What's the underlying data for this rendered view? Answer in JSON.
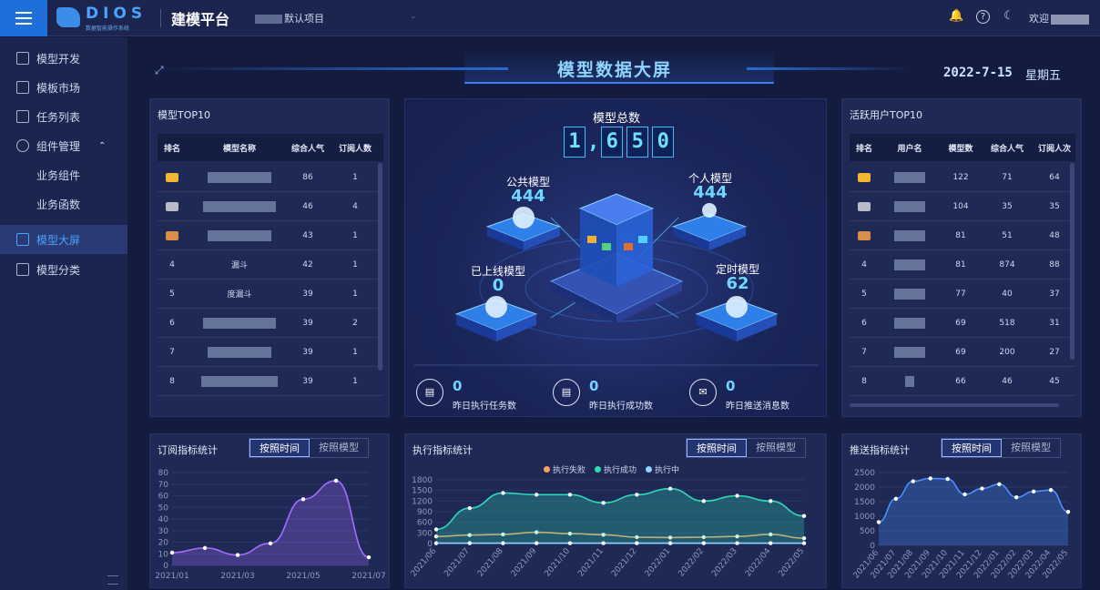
{
  "topbar": {
    "logo_text": "DIOS",
    "logo_sub": "数据智能操作系统",
    "platform": "建模平台",
    "project": "默认项目",
    "welcome": "欢迎"
  },
  "sidebar": {
    "items": [
      {
        "label": "模型开发"
      },
      {
        "label": "模板市场"
      },
      {
        "label": "任务列表"
      },
      {
        "label": "组件管理"
      },
      {
        "label": "业务组件"
      },
      {
        "label": "业务函数"
      },
      {
        "label": "模型大屏"
      },
      {
        "label": "模型分类"
      }
    ]
  },
  "screen": {
    "title": "模型数据大屏",
    "date": "2022-7-15",
    "weekday": "星期五"
  },
  "model_top10": {
    "title": "模型TOP10",
    "columns": [
      "排名",
      "模型名称",
      "综合人气",
      "订阅人数"
    ],
    "rows": [
      {
        "rank": "",
        "name": "",
        "popularity": "86",
        "subscribers": "1"
      },
      {
        "rank": "",
        "name": "",
        "popularity": "46",
        "subscribers": "4"
      },
      {
        "rank": "",
        "name": "",
        "popularity": "43",
        "subscribers": "1"
      },
      {
        "rank": "4",
        "name": "漏斗",
        "popularity": "42",
        "subscribers": "1"
      },
      {
        "rank": "5",
        "name": "度漏斗",
        "popularity": "39",
        "subscribers": "1"
      },
      {
        "rank": "6",
        "name": "",
        "popularity": "39",
        "subscribers": "2"
      },
      {
        "rank": "7",
        "name": "",
        "popularity": "39",
        "subscribers": "1"
      },
      {
        "rank": "8",
        "name": "",
        "popularity": "39",
        "subscribers": "1"
      }
    ]
  },
  "overview": {
    "total_label": "模型总数",
    "total_digits": [
      "1",
      ",",
      "6",
      "5",
      "0"
    ],
    "public_label": "公共模型",
    "public_value": "444",
    "personal_label": "个人模型",
    "personal_value": "444",
    "online_label": "已上线模型",
    "online_value": "0",
    "scheduled_label": "定时模型",
    "scheduled_value": "62",
    "bottom": [
      {
        "value": "0",
        "label": "昨日执行任务数"
      },
      {
        "value": "0",
        "label": "昨日执行成功数"
      },
      {
        "value": "0",
        "label": "昨日推送消息数"
      }
    ]
  },
  "user_top10": {
    "title": "活跃用户TOP10",
    "columns": [
      "排名",
      "用户名",
      "模型数",
      "综合人气",
      "订阅人次"
    ],
    "rows": [
      {
        "rank": "",
        "models": "122",
        "popularity": "71",
        "subs": "64"
      },
      {
        "rank": "",
        "models": "104",
        "popularity": "35",
        "subs": "35"
      },
      {
        "rank": "",
        "models": "81",
        "popularity": "51",
        "subs": "48"
      },
      {
        "rank": "4",
        "models": "81",
        "popularity": "874",
        "subs": "88"
      },
      {
        "rank": "5",
        "models": "77",
        "popularity": "40",
        "subs": "37"
      },
      {
        "rank": "6",
        "models": "69",
        "popularity": "518",
        "subs": "31"
      },
      {
        "rank": "7",
        "models": "69",
        "popularity": "200",
        "subs": "27"
      },
      {
        "rank": "8",
        "models": "66",
        "popularity": "46",
        "subs": "45"
      }
    ]
  },
  "tabs": {
    "by_time": "按照时间",
    "by_model": "按照模型"
  },
  "subscribe_panel": {
    "title": "订阅指标统计"
  },
  "exec_panel": {
    "title": "执行指标统计"
  },
  "push_panel": {
    "title": "推送指标统计"
  },
  "chart_data": [
    {
      "type": "area",
      "yticks": [
        0,
        10,
        20,
        30,
        40,
        50,
        60,
        70,
        80
      ],
      "ylim": [
        0,
        80
      ],
      "xticks": [
        "2021/01",
        "2021/03",
        "2021/05",
        "2021/07"
      ],
      "points": [
        [
          0,
          11
        ],
        [
          1,
          15
        ],
        [
          2,
          9
        ],
        [
          3,
          19
        ],
        [
          4,
          57
        ],
        [
          5,
          73
        ],
        [
          6,
          7
        ]
      ],
      "x_count": 7,
      "tick_index": [
        0,
        2,
        4,
        6
      ],
      "color": "#a46cff"
    },
    {
      "type": "line",
      "yticks": [
        0,
        300,
        600,
        900,
        1200,
        1500,
        1800
      ],
      "ylim": [
        0,
        1800
      ],
      "categories": [
        "2021/06",
        "2021/07",
        "2021/08",
        "2021/09",
        "2021/10",
        "2021/11",
        "2021/12",
        "2022/01",
        "2022/02",
        "2022/03",
        "2022/04",
        "2022/05"
      ],
      "series": [
        {
          "name": "执行失败",
          "color": "#f5a45a",
          "values": [
            200,
            240,
            260,
            320,
            280,
            250,
            180,
            170,
            180,
            200,
            260,
            150
          ]
        },
        {
          "name": "执行成功",
          "color": "#2fd9b8",
          "values": [
            400,
            1000,
            1430,
            1380,
            1380,
            1150,
            1380,
            1550,
            1200,
            1350,
            1200,
            780
          ]
        },
        {
          "name": "执行中",
          "color": "#8fd3ff",
          "values": [
            10,
            10,
            10,
            10,
            10,
            10,
            10,
            10,
            10,
            10,
            10,
            10
          ]
        }
      ]
    },
    {
      "type": "area",
      "yticks": [
        0,
        500,
        1000,
        1500,
        2000,
        2500
      ],
      "ylim": [
        0,
        2500
      ],
      "categories": [
        "2021/06",
        "2021/07",
        "2021/08",
        "2021/09",
        "2021/10",
        "2021/11",
        "2021/12",
        "2022/01",
        "2022/02",
        "2022/03",
        "2022/04",
        "2022/05"
      ],
      "points": [
        [
          0,
          800
        ],
        [
          1,
          1600
        ],
        [
          2,
          2200
        ],
        [
          3,
          2300
        ],
        [
          4,
          2280
        ],
        [
          5,
          1750
        ],
        [
          6,
          1950
        ],
        [
          7,
          2100
        ],
        [
          8,
          1650
        ],
        [
          9,
          1850
        ],
        [
          10,
          1900
        ],
        [
          11,
          1150
        ]
      ],
      "color": "#4a90ff"
    }
  ]
}
